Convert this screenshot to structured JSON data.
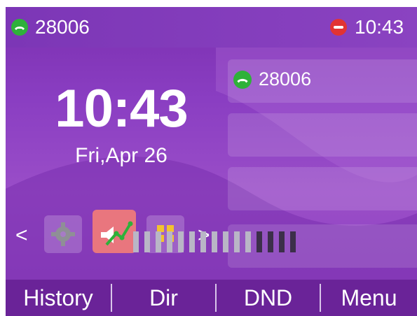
{
  "status_bar": {
    "line_number": "28006",
    "time": "10:43"
  },
  "clock": {
    "time": "10:43",
    "date": "Fri,Apr 26"
  },
  "line_keys": [
    {
      "label": "28006"
    },
    {
      "label": ""
    },
    {
      "label": ""
    },
    {
      "label": ""
    }
  ],
  "nav": {
    "prev": "<",
    "next": ">"
  },
  "volume": {
    "level": 11,
    "max": 15
  },
  "softkeys": [
    {
      "label": "History"
    },
    {
      "label": "Dir"
    },
    {
      "label": "DND"
    },
    {
      "label": "Menu"
    }
  ],
  "colors": {
    "line_registered": "#2eb13a",
    "dnd_active": "#e23333",
    "volume_tile": "#e9767e"
  },
  "icons": {
    "status_line": "handset-icon",
    "status_dnd": "dnd-icon",
    "settings": "gear-icon",
    "volume": "speaker-icon",
    "apps": "apps-grid-icon"
  }
}
